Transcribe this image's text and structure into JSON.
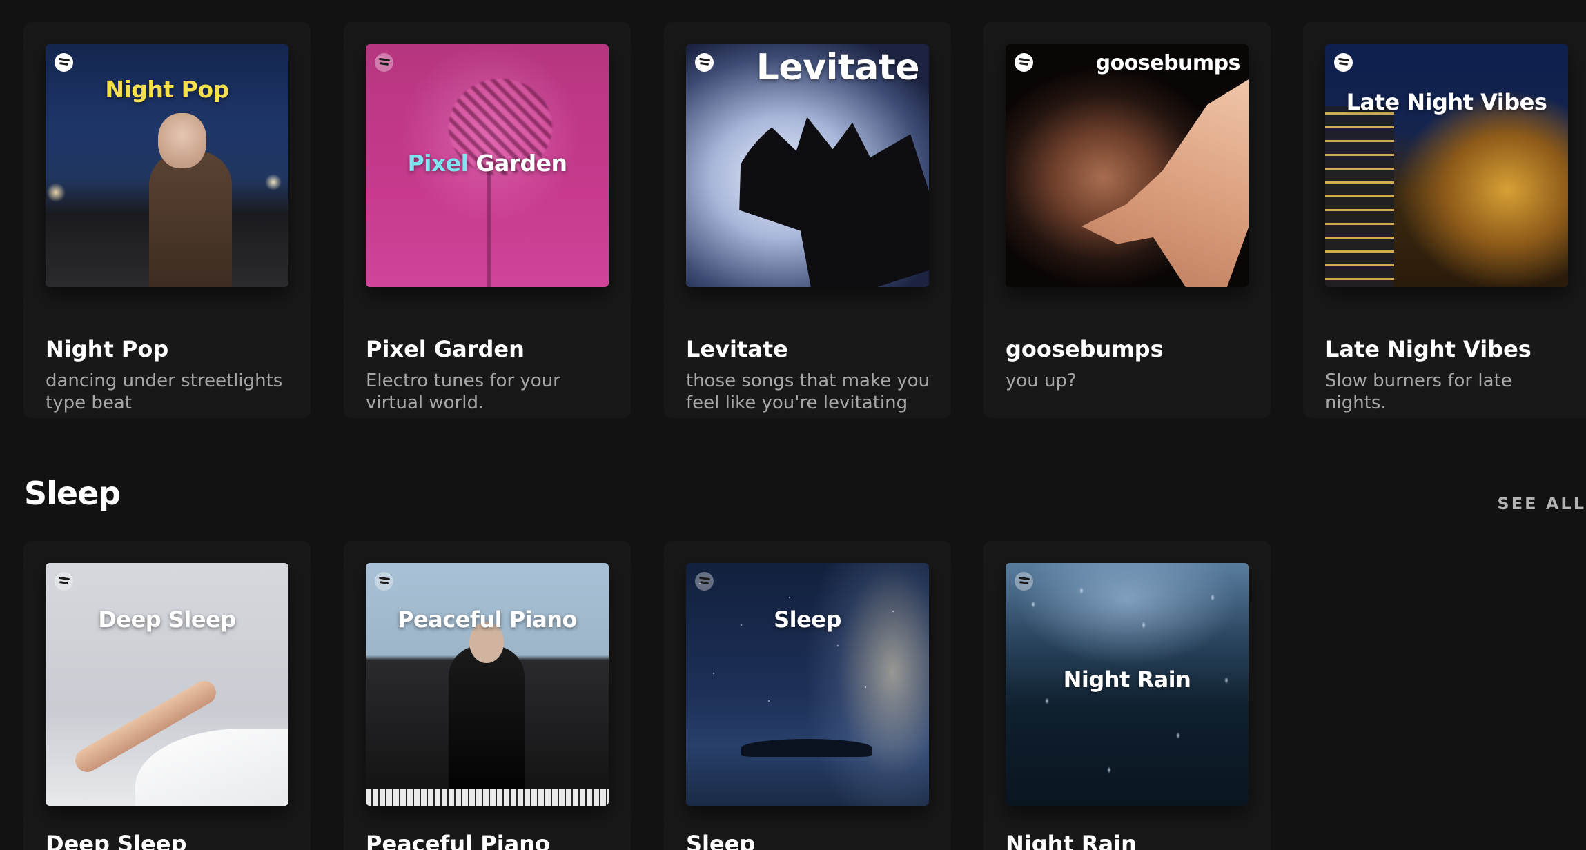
{
  "top_row": {
    "cards": [
      {
        "title": "Night Pop",
        "description": "dancing under streetlights type beat",
        "cover_text": "Night Pop",
        "cover_text_color": "#f4e04d"
      },
      {
        "title": "Pixel Garden",
        "description": "Electro tunes for your virtual world.",
        "cover_text_a": "Pixel",
        "cover_text_b": "Garden",
        "cover_text_a_color": "#7fe3f0"
      },
      {
        "title": "Levitate",
        "description": "those songs that make you feel like you're levitating",
        "cover_text": "Levitate"
      },
      {
        "title": "goosebumps",
        "description": "you up?",
        "cover_text": "goosebumps"
      },
      {
        "title": "Late Night Vibes",
        "description": "Slow burners for late nights.",
        "cover_text": "Late Night Vibes"
      }
    ]
  },
  "sleep_section": {
    "title": "Sleep",
    "see_all": "SEE ALL",
    "cards": [
      {
        "title": "Deep Sleep",
        "cover_text": "Deep Sleep"
      },
      {
        "title": "Peaceful Piano",
        "cover_text": "Peaceful Piano"
      },
      {
        "title": "Sleep",
        "cover_text": "Sleep"
      },
      {
        "title": "Night Rain",
        "cover_text": "Night Rain"
      }
    ]
  },
  "icons": {
    "cover_badge": "spotify-logo-icon"
  },
  "colors": {
    "background": "#121212",
    "card": "#181818",
    "title": "#ffffff",
    "description": "#a7a7a7",
    "see_all": "#b3b3b3"
  }
}
